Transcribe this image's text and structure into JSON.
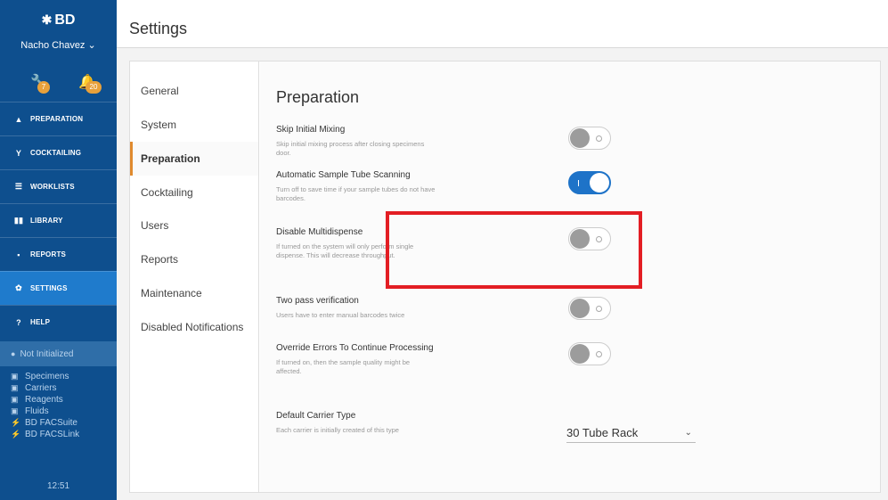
{
  "sidebar": {
    "brand": "BD",
    "user": "Nacho Chavez ⌄",
    "alerts": [
      {
        "icon": "wrench-icon",
        "count": "7"
      },
      {
        "icon": "bell-icon",
        "count": "20"
      }
    ],
    "nav": [
      {
        "label": "PREPARATION",
        "icon": "flask-icon"
      },
      {
        "label": "COCKTAILING",
        "icon": "cocktail-icon"
      },
      {
        "label": "WORKLISTS",
        "icon": "list-icon"
      },
      {
        "label": "LIBRARY",
        "icon": "book-icon"
      },
      {
        "label": "REPORTS",
        "icon": "document-icon"
      },
      {
        "label": "SETTINGS",
        "icon": "gear-icon",
        "active": true
      },
      {
        "label": "HELP",
        "icon": "help-icon"
      }
    ],
    "status": "Not Initialized",
    "subitems": [
      {
        "label": "Specimens",
        "icon": "box-icon"
      },
      {
        "label": "Carriers",
        "icon": "box-icon"
      },
      {
        "label": "Reagents",
        "icon": "box-icon"
      },
      {
        "label": "Fluids",
        "icon": "box-icon"
      },
      {
        "label": "BD FACSuite",
        "icon": "link-icon"
      },
      {
        "label": "BD FACSLink",
        "icon": "link-icon"
      }
    ],
    "clock": "12:51"
  },
  "header": {
    "title": "Settings"
  },
  "menu": [
    "General",
    "System",
    "Preparation",
    "Cocktailing",
    "Users",
    "Reports",
    "Maintenance",
    "Disabled Notifications"
  ],
  "active_menu": "Preparation",
  "content": {
    "title": "Preparation",
    "settings": [
      {
        "label": "Skip Initial Mixing",
        "desc": "Skip initial mixing process after closing specimens door.",
        "state": "off"
      },
      {
        "label": "Automatic Sample Tube Scanning",
        "desc": "Turn off to save time if your sample tubes do not have barcodes.",
        "state": "on"
      },
      {
        "label": "Disable Multidispense",
        "desc": "If turned on the system will only perform single dispense. This will decrease throughput.",
        "state": "off"
      },
      {
        "label": "Two pass verification",
        "desc": "Users have to enter manual barcodes twice",
        "state": "off"
      },
      {
        "label": "Override Errors To Continue Processing",
        "desc": "If turned on, then the sample quality might be affected.",
        "state": "off"
      }
    ],
    "carrier": {
      "label": "Default Carrier Type",
      "desc": "Each carrier is initially created of this type",
      "value": "30 Tube Rack"
    }
  },
  "colors": {
    "sidebar": "#0e4f8e",
    "active_nav": "#1f7bcc",
    "accent": "#e08a2e",
    "toggle_on": "#1e73c8",
    "highlight": "#e31e24"
  }
}
